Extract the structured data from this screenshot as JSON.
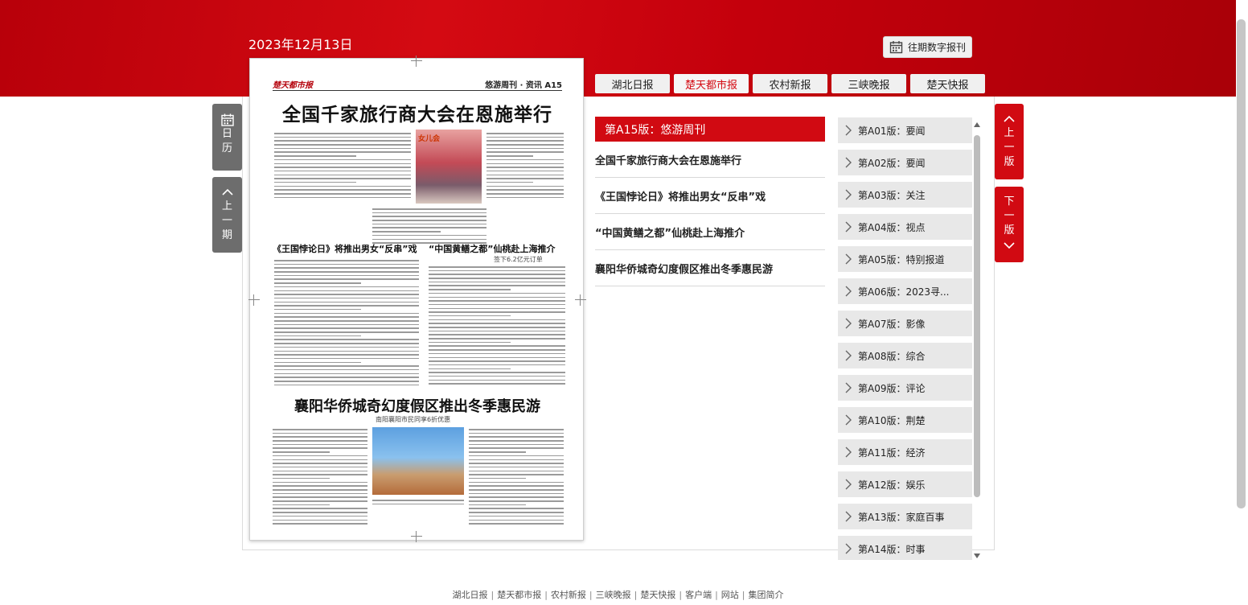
{
  "header": {
    "date": "2023年12月13日",
    "archive_button": "往期数字报刊",
    "tabs": [
      {
        "label": "湖北日报"
      },
      {
        "label": "楚天都市报"
      },
      {
        "label": "农村新报"
      },
      {
        "label": "三峡晚报"
      },
      {
        "label": "楚天快报"
      }
    ]
  },
  "side_nav": {
    "calendar": [
      "日",
      "历"
    ],
    "prev_issue": [
      "上",
      "一",
      "期"
    ],
    "prev_page": [
      "上",
      "一",
      "版"
    ],
    "next_page": [
      "下",
      "一",
      "版"
    ]
  },
  "paper": {
    "masthead_logo": "楚天都市报",
    "masthead_section": "悠游周刊 · 资讯 A15",
    "headline_main": "全国千家旅行商大会在恩施举行",
    "headline_mid_left": "《王国悖论日》将推出男女“反串”戏",
    "headline_mid_right": "“中国黄鳝之都”仙桃赴上海推介",
    "subhead_mid_right": "签下6.2亿元订单",
    "headline_bottom": "襄阳华侨城奇幻度假区推出冬季惠民游",
    "subhead_bottom": "南阳襄阳市民同享6折优惠",
    "photo1_label": "女儿会"
  },
  "section_title": "第A15版：悠游周刊",
  "articles": [
    "全国千家旅行商大会在恩施举行",
    "《王国悖论日》将推出男女“反串”戏",
    "“中国黄鳝之都”仙桃赴上海推介",
    "襄阳华侨城奇幻度假区推出冬季惠民游"
  ],
  "editions": [
    "第A01版：要闻",
    "第A02版：要闻",
    "第A03版：关注",
    "第A04版：视点",
    "第A05版：特别报道",
    "第A06版：2023寻...",
    "第A07版：影像",
    "第A08版：综合",
    "第A09版：评论",
    "第A10版：荆楚",
    "第A11版：经济",
    "第A12版：娱乐",
    "第A13版：家庭百事",
    "第A14版：时事"
  ],
  "footer_links": [
    "湖北日报",
    "楚天都市报",
    "农村新报",
    "三峡晚报",
    "楚天快报",
    "客户端",
    "网站",
    "集团简介"
  ],
  "colors": {
    "brand_red": "#d10a12",
    "side_gray": "#6d6d6d"
  },
  "icons": {
    "calendar": "calendar-icon",
    "chevron_up": "chevron-up-icon",
    "chevron_down": "chevron-down-icon",
    "chevron_right": "chevron-right-icon"
  }
}
